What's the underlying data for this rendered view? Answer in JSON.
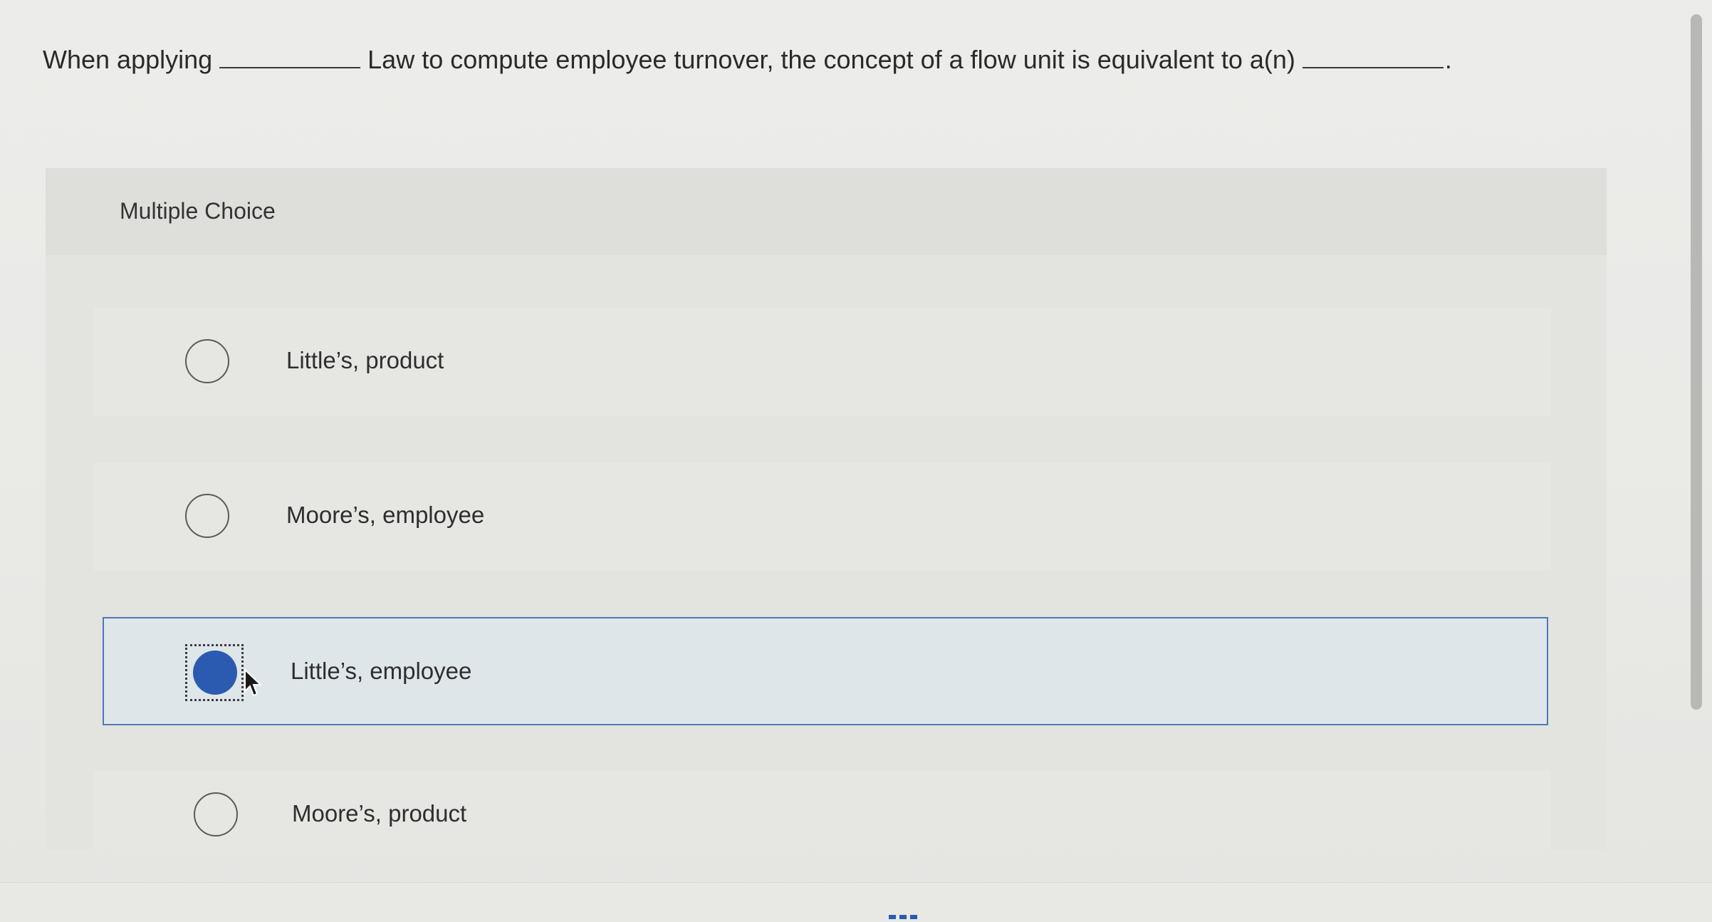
{
  "question": {
    "part1": "When applying",
    "part2": "Law to compute employee turnover, the concept of a flow unit is equivalent to a(n)",
    "part3": "."
  },
  "multiple_choice": {
    "title": "Multiple Choice",
    "options": [
      {
        "label": "Little’s, product",
        "selected": false
      },
      {
        "label": "Moore’s, employee",
        "selected": false
      },
      {
        "label": "Little’s, employee",
        "selected": true
      },
      {
        "label": "Moore’s, product",
        "selected": false
      }
    ]
  },
  "colors": {
    "selected_fill": "#2b5bb0",
    "selected_border": "#4d79b6",
    "selected_bg": "#dfe6ea"
  },
  "icons": {
    "cursor": "arrow-cursor-icon",
    "more": "more-dots-icon"
  }
}
